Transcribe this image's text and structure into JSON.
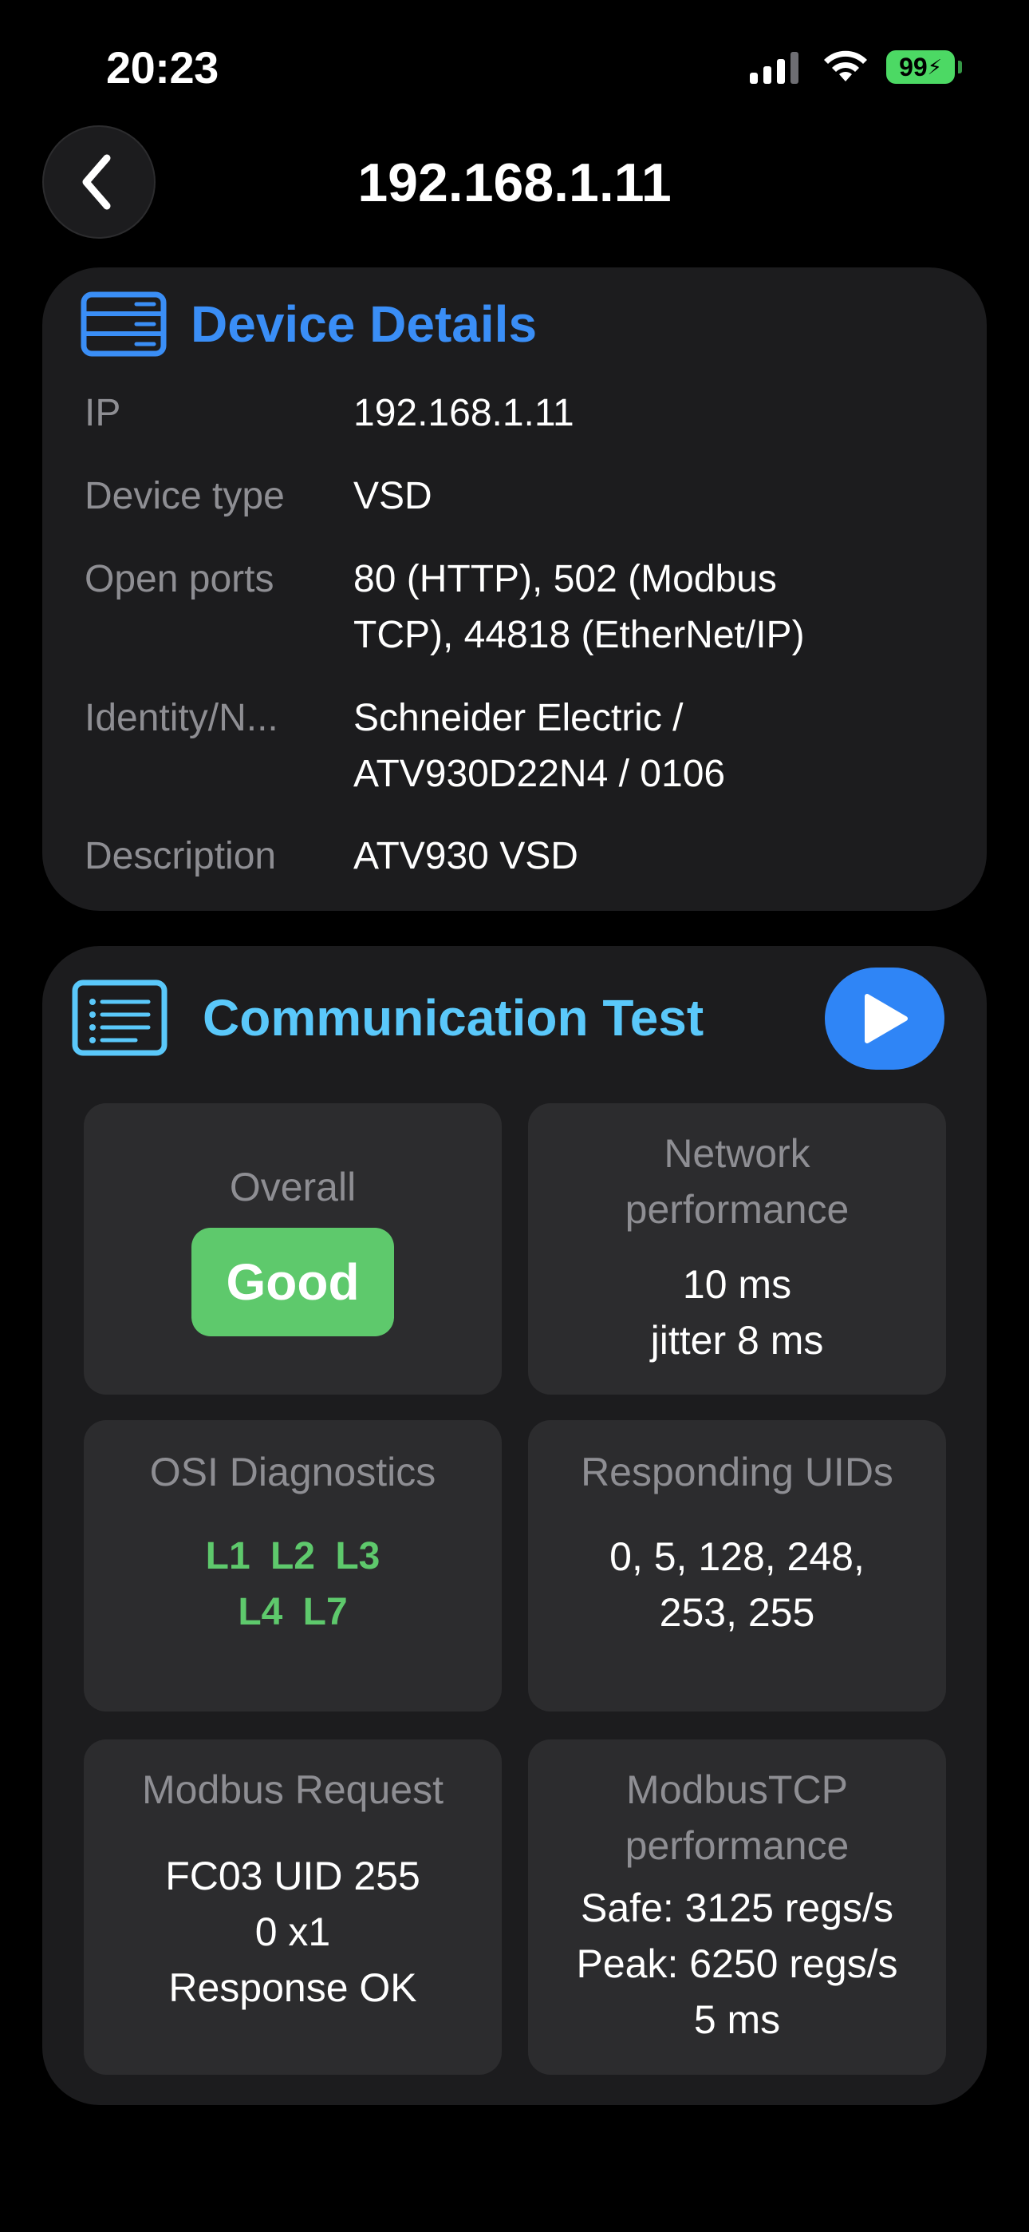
{
  "status_bar": {
    "time": "20:23",
    "battery": "99"
  },
  "nav": {
    "title": "192.168.1.11"
  },
  "device_details": {
    "title": "Device Details",
    "rows": [
      {
        "label": "IP",
        "value_lines": [
          "192.168.1.11"
        ]
      },
      {
        "label": "Device type",
        "value_lines": [
          "VSD"
        ]
      },
      {
        "label": "Open ports",
        "value_lines": [
          "80 (HTTP), 502 (Modbus",
          "TCP), 44818 (EtherNet/IP)"
        ]
      },
      {
        "label": "Identity/N...",
        "value_lines": [
          "Schneider Electric /",
          "ATV930D22N4 / 0106"
        ]
      },
      {
        "label": "Description",
        "value_lines": [
          "ATV930 VSD"
        ]
      }
    ]
  },
  "communication_test": {
    "title": "Communication Test",
    "tiles": {
      "overall": {
        "label": "Overall",
        "badge": "Good",
        "badge_color": "#5ec96c"
      },
      "network": {
        "label_lines": [
          "Network",
          "performance"
        ],
        "value_lines": [
          "10 ms",
          "jitter 8 ms"
        ]
      },
      "osi": {
        "label": "OSI Diagnostics",
        "layers_row1": [
          "L1",
          "L2",
          "L3"
        ],
        "layers_row2": [
          "L4",
          "L7"
        ],
        "color": "#5ec96c"
      },
      "uids": {
        "label": "Responding UIDs",
        "value_lines": [
          "0, 5, 128, 248,",
          "253, 255"
        ]
      },
      "modbus_request": {
        "label": "Modbus Request",
        "value_lines": [
          "FC03 UID 255",
          "0 x1",
          "Response OK"
        ]
      },
      "modbus_perf": {
        "label_lines": [
          "ModbusTCP",
          "performance"
        ],
        "value_lines": [
          "Safe: 3125 regs/s",
          "Peak: 6250 regs/s",
          "5 ms"
        ]
      }
    }
  },
  "colors": {
    "accent_blue": "#3a8ef6",
    "accent_cyan": "#5ac8fa",
    "success_green": "#5ec96c",
    "card_bg": "#1c1c1e",
    "tile_bg": "#2c2c2e"
  },
  "icons": {
    "back": "chevron-left-icon",
    "device": "server-icon",
    "comm": "list-icon",
    "play": "play-icon"
  }
}
